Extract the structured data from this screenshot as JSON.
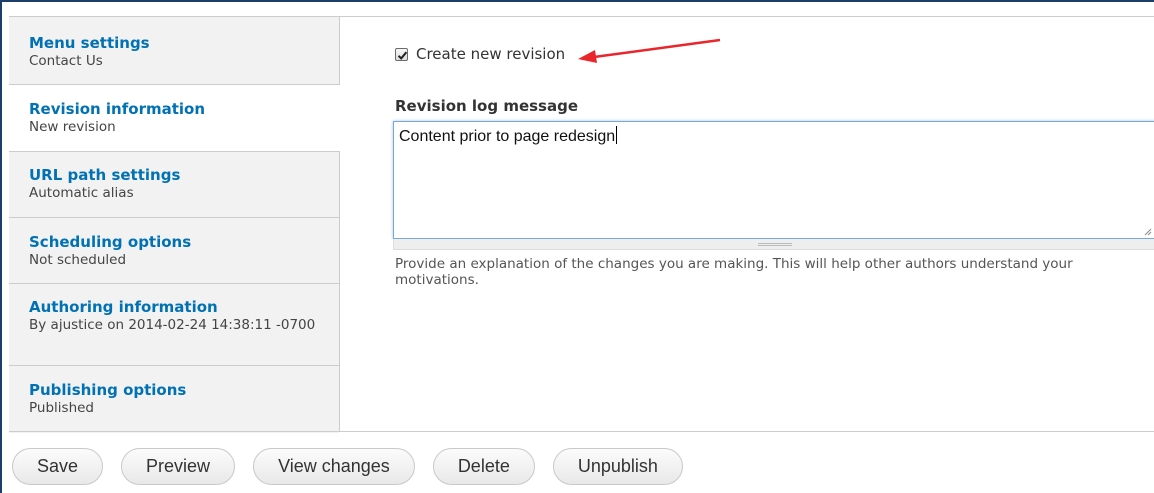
{
  "sidebar": {
    "items": [
      {
        "title": "Menu settings",
        "summary": "Contact Us"
      },
      {
        "title": "Revision information",
        "summary": "New revision"
      },
      {
        "title": "URL path settings",
        "summary": "Automatic alias"
      },
      {
        "title": "Scheduling options",
        "summary": "Not scheduled"
      },
      {
        "title": "Authoring information",
        "summary": "By ajustice on 2014-02-24 14:38:11 -0700"
      },
      {
        "title": "Publishing options",
        "summary": "Published"
      }
    ]
  },
  "revision": {
    "create_label": "Create new revision",
    "create_checked": true,
    "log_title": "Revision log message",
    "log_value": "Content prior to page redesign",
    "description": "Provide an explanation of the changes you are making. This will help other authors understand your motivations."
  },
  "actions": {
    "save": "Save",
    "preview": "Preview",
    "view_changes": "View changes",
    "delete": "Delete",
    "unpublish": "Unpublish"
  },
  "colors": {
    "link": "#0071b3",
    "annotation_arrow": "#e8262b"
  }
}
